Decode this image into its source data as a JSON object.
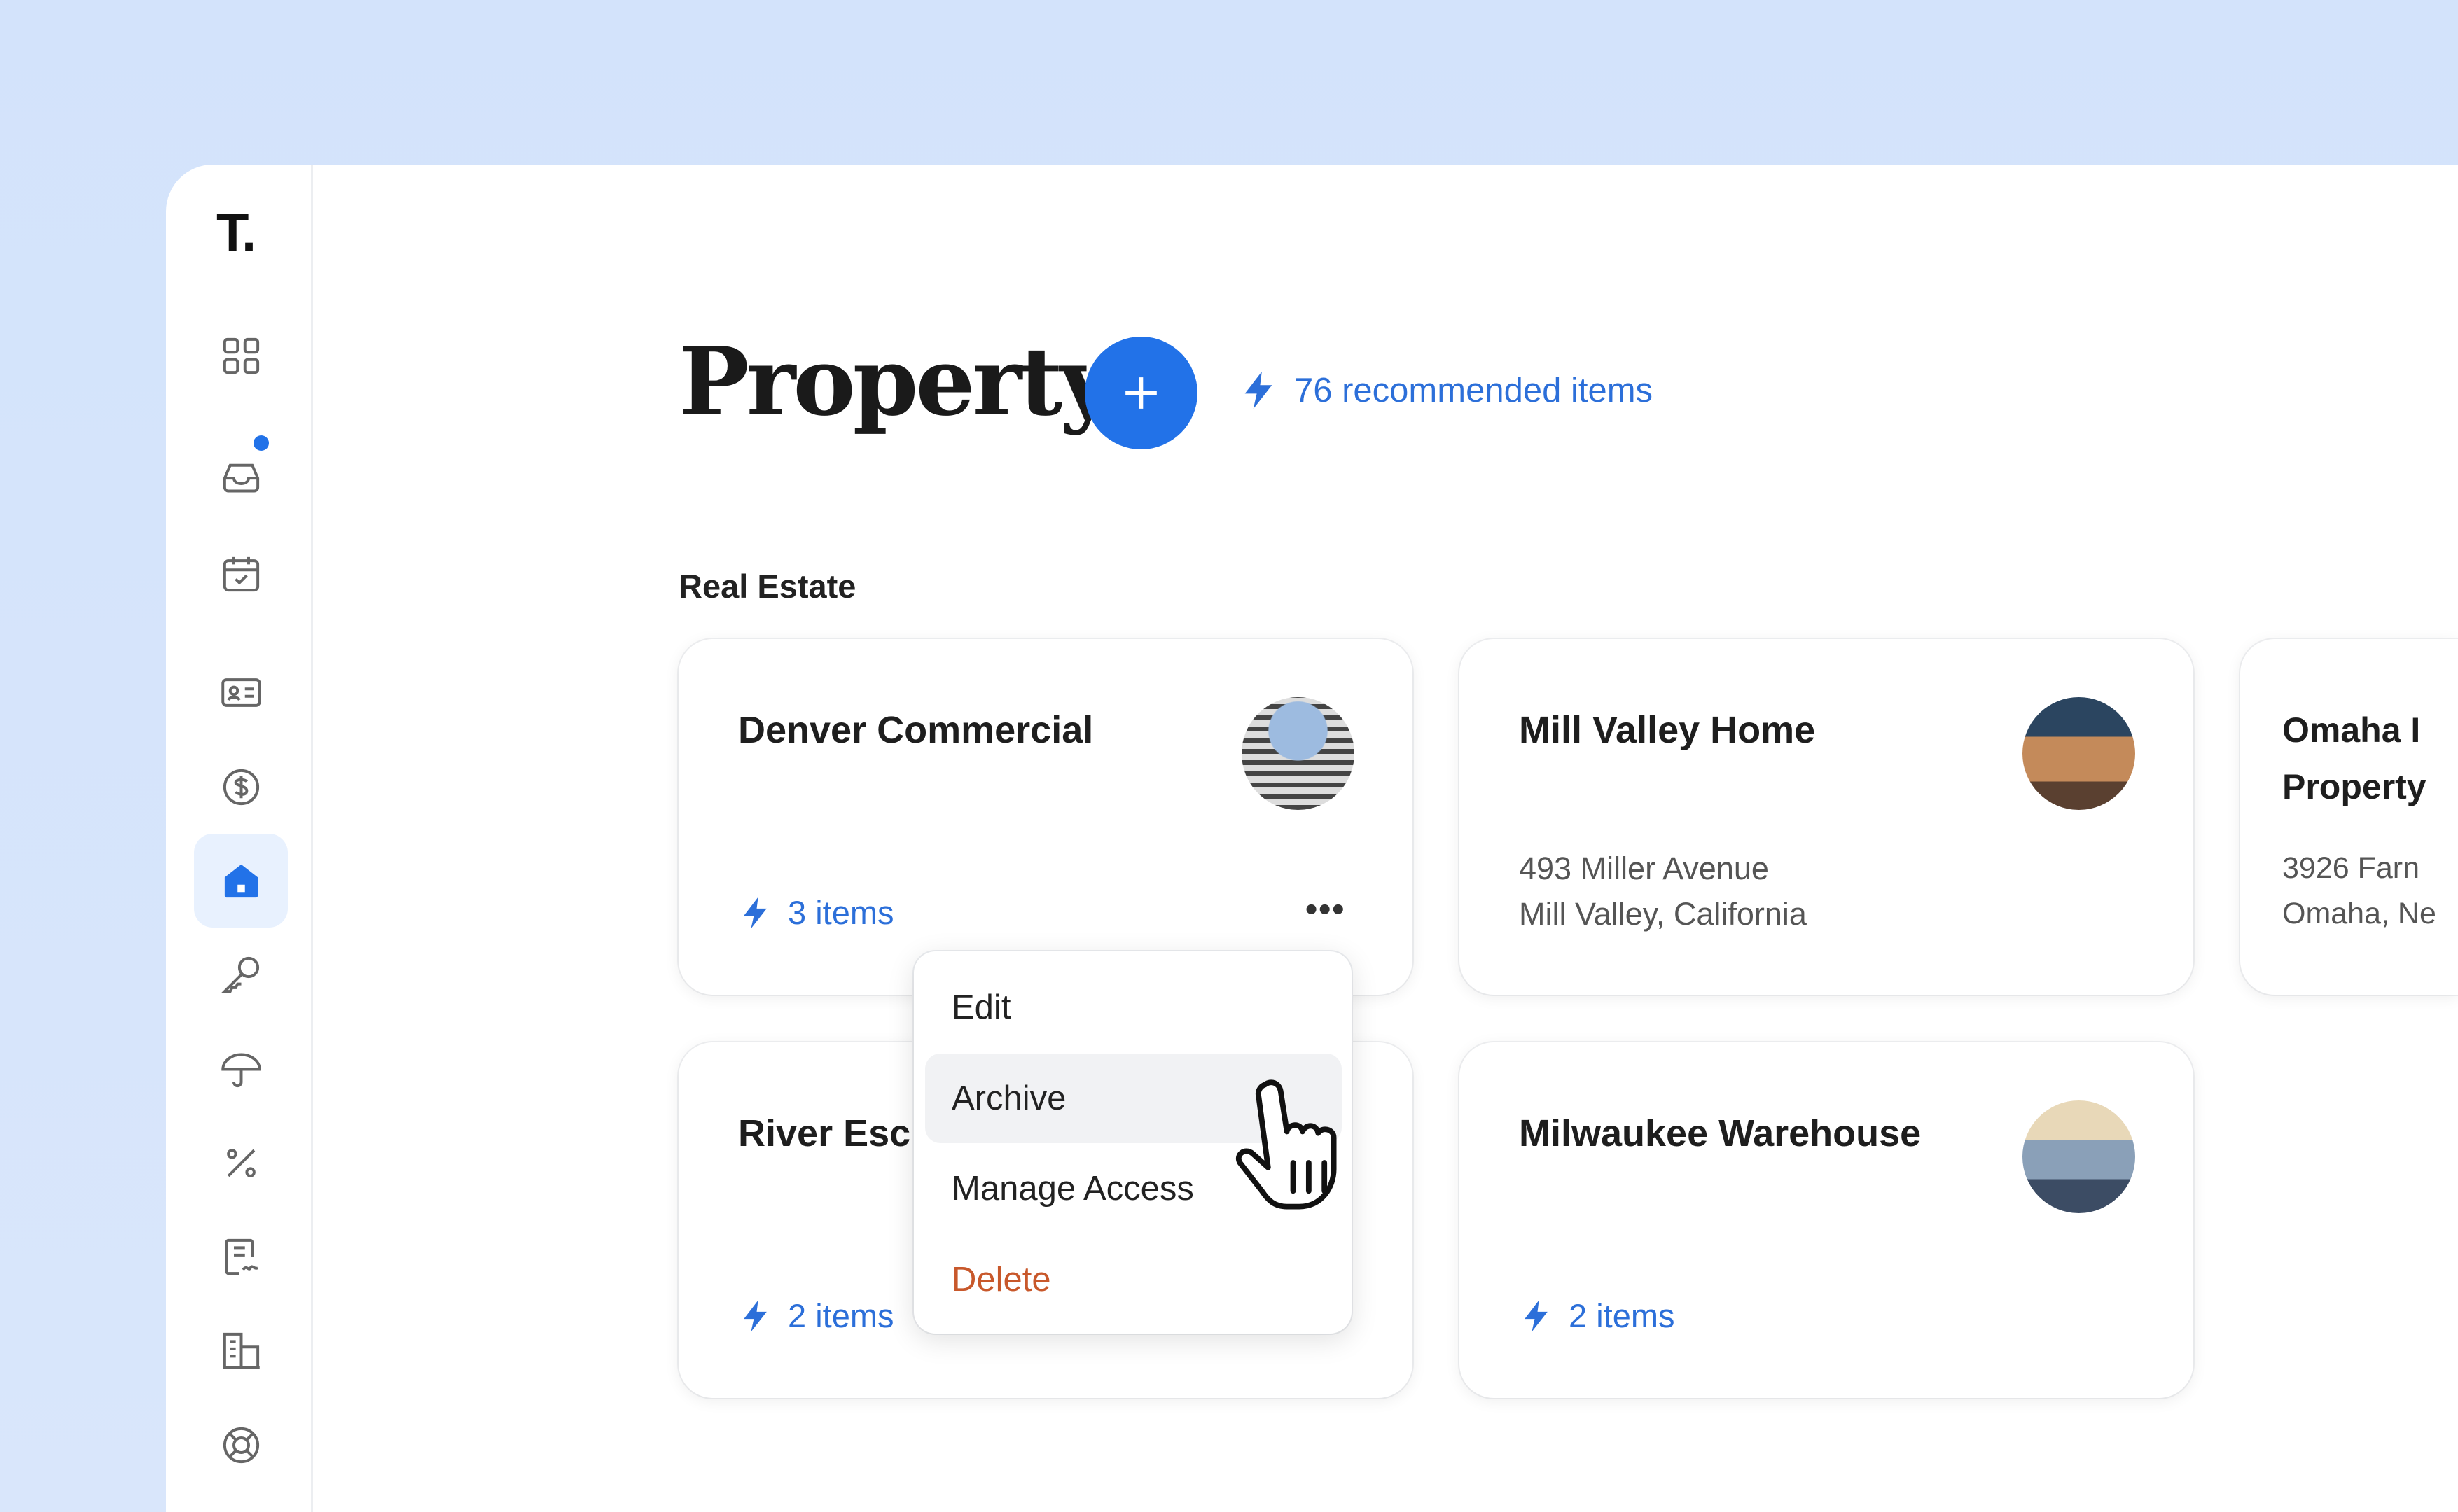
{
  "app": {
    "logo": "T."
  },
  "sidebar": {
    "items": [
      {
        "icon": "grid-icon",
        "active": false
      },
      {
        "icon": "inbox-icon",
        "active": false,
        "notification": true
      },
      {
        "icon": "calendar-check-icon",
        "active": false
      },
      {
        "icon": "contact-card-icon",
        "active": false
      },
      {
        "icon": "dollar-coin-icon",
        "active": false
      },
      {
        "icon": "home-icon",
        "active": true
      },
      {
        "icon": "key-icon",
        "active": false
      },
      {
        "icon": "umbrella-icon",
        "active": false
      },
      {
        "icon": "percent-icon",
        "active": false
      },
      {
        "icon": "contract-icon",
        "active": false
      },
      {
        "icon": "building-icon",
        "active": false
      },
      {
        "icon": "lifebuoy-icon",
        "active": false
      }
    ]
  },
  "header": {
    "title": "Property",
    "recommended": "76 recommended items"
  },
  "section": {
    "title": "Real Estate"
  },
  "cards": [
    {
      "title": "Denver Commercial",
      "items": "3 items"
    },
    {
      "title": "Mill Valley Home",
      "address1": "493 Miller Avenue",
      "address2": "Mill Valley, California"
    },
    {
      "title": "Omaha I Property",
      "address1": "3926 Farn",
      "address2": "Omaha, Ne"
    },
    {
      "title": "River Esc",
      "items": "2 items"
    },
    {
      "title": "Milwaukee Warehouse",
      "items": "2 items"
    }
  ],
  "menu": {
    "items": [
      "Edit",
      "Archive",
      "Manage Access",
      "Delete"
    ],
    "highlighted": "Archive"
  },
  "colors": {
    "accent": "#2272e8",
    "link": "#2c6fd9",
    "danger": "#c8582b",
    "background": "#d6e4fb"
  }
}
